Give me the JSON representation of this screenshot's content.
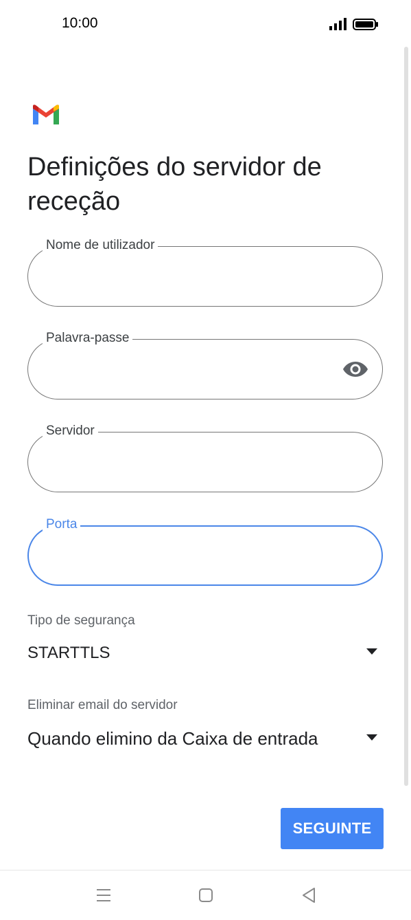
{
  "status_bar": {
    "time": "10:00",
    "icons": [
      "signal-icon",
      "battery-icon"
    ]
  },
  "app": {
    "logo_icon": "gmail-logo-icon",
    "brand_colors": {
      "blue": "#4285f4",
      "red": "#ea4335",
      "yellow": "#fbbc04",
      "green": "#34a853",
      "dark_red": "#c5221f"
    }
  },
  "page": {
    "title": "Definições do servidor de receção"
  },
  "form": {
    "username": {
      "label": "Nome de utilizador",
      "value": ""
    },
    "password": {
      "label": "Palavra-passe",
      "value": "",
      "toggle_icon": "visibility-eye-icon"
    },
    "server": {
      "label": "Servidor",
      "value": ""
    },
    "port": {
      "label": "Porta",
      "value": "",
      "focused": true
    },
    "security_type": {
      "label": "Tipo de segurança",
      "value": "STARTTLS",
      "icon": "dropdown-arrow-icon"
    },
    "delete_from_server": {
      "label": "Eliminar email do servidor",
      "value": "Quando elimino da Caixa de entrada",
      "icon": "dropdown-arrow-icon"
    }
  },
  "actions": {
    "next_label": "SEGUINTE"
  },
  "colors": {
    "accent": "#4285f4",
    "focus_border": "#4a86e8",
    "field_border": "#757575",
    "text_primary": "#202124",
    "text_secondary": "#5f6368"
  },
  "nav_bar": {
    "icons": [
      "menu-icon",
      "home-icon",
      "back-icon"
    ]
  }
}
